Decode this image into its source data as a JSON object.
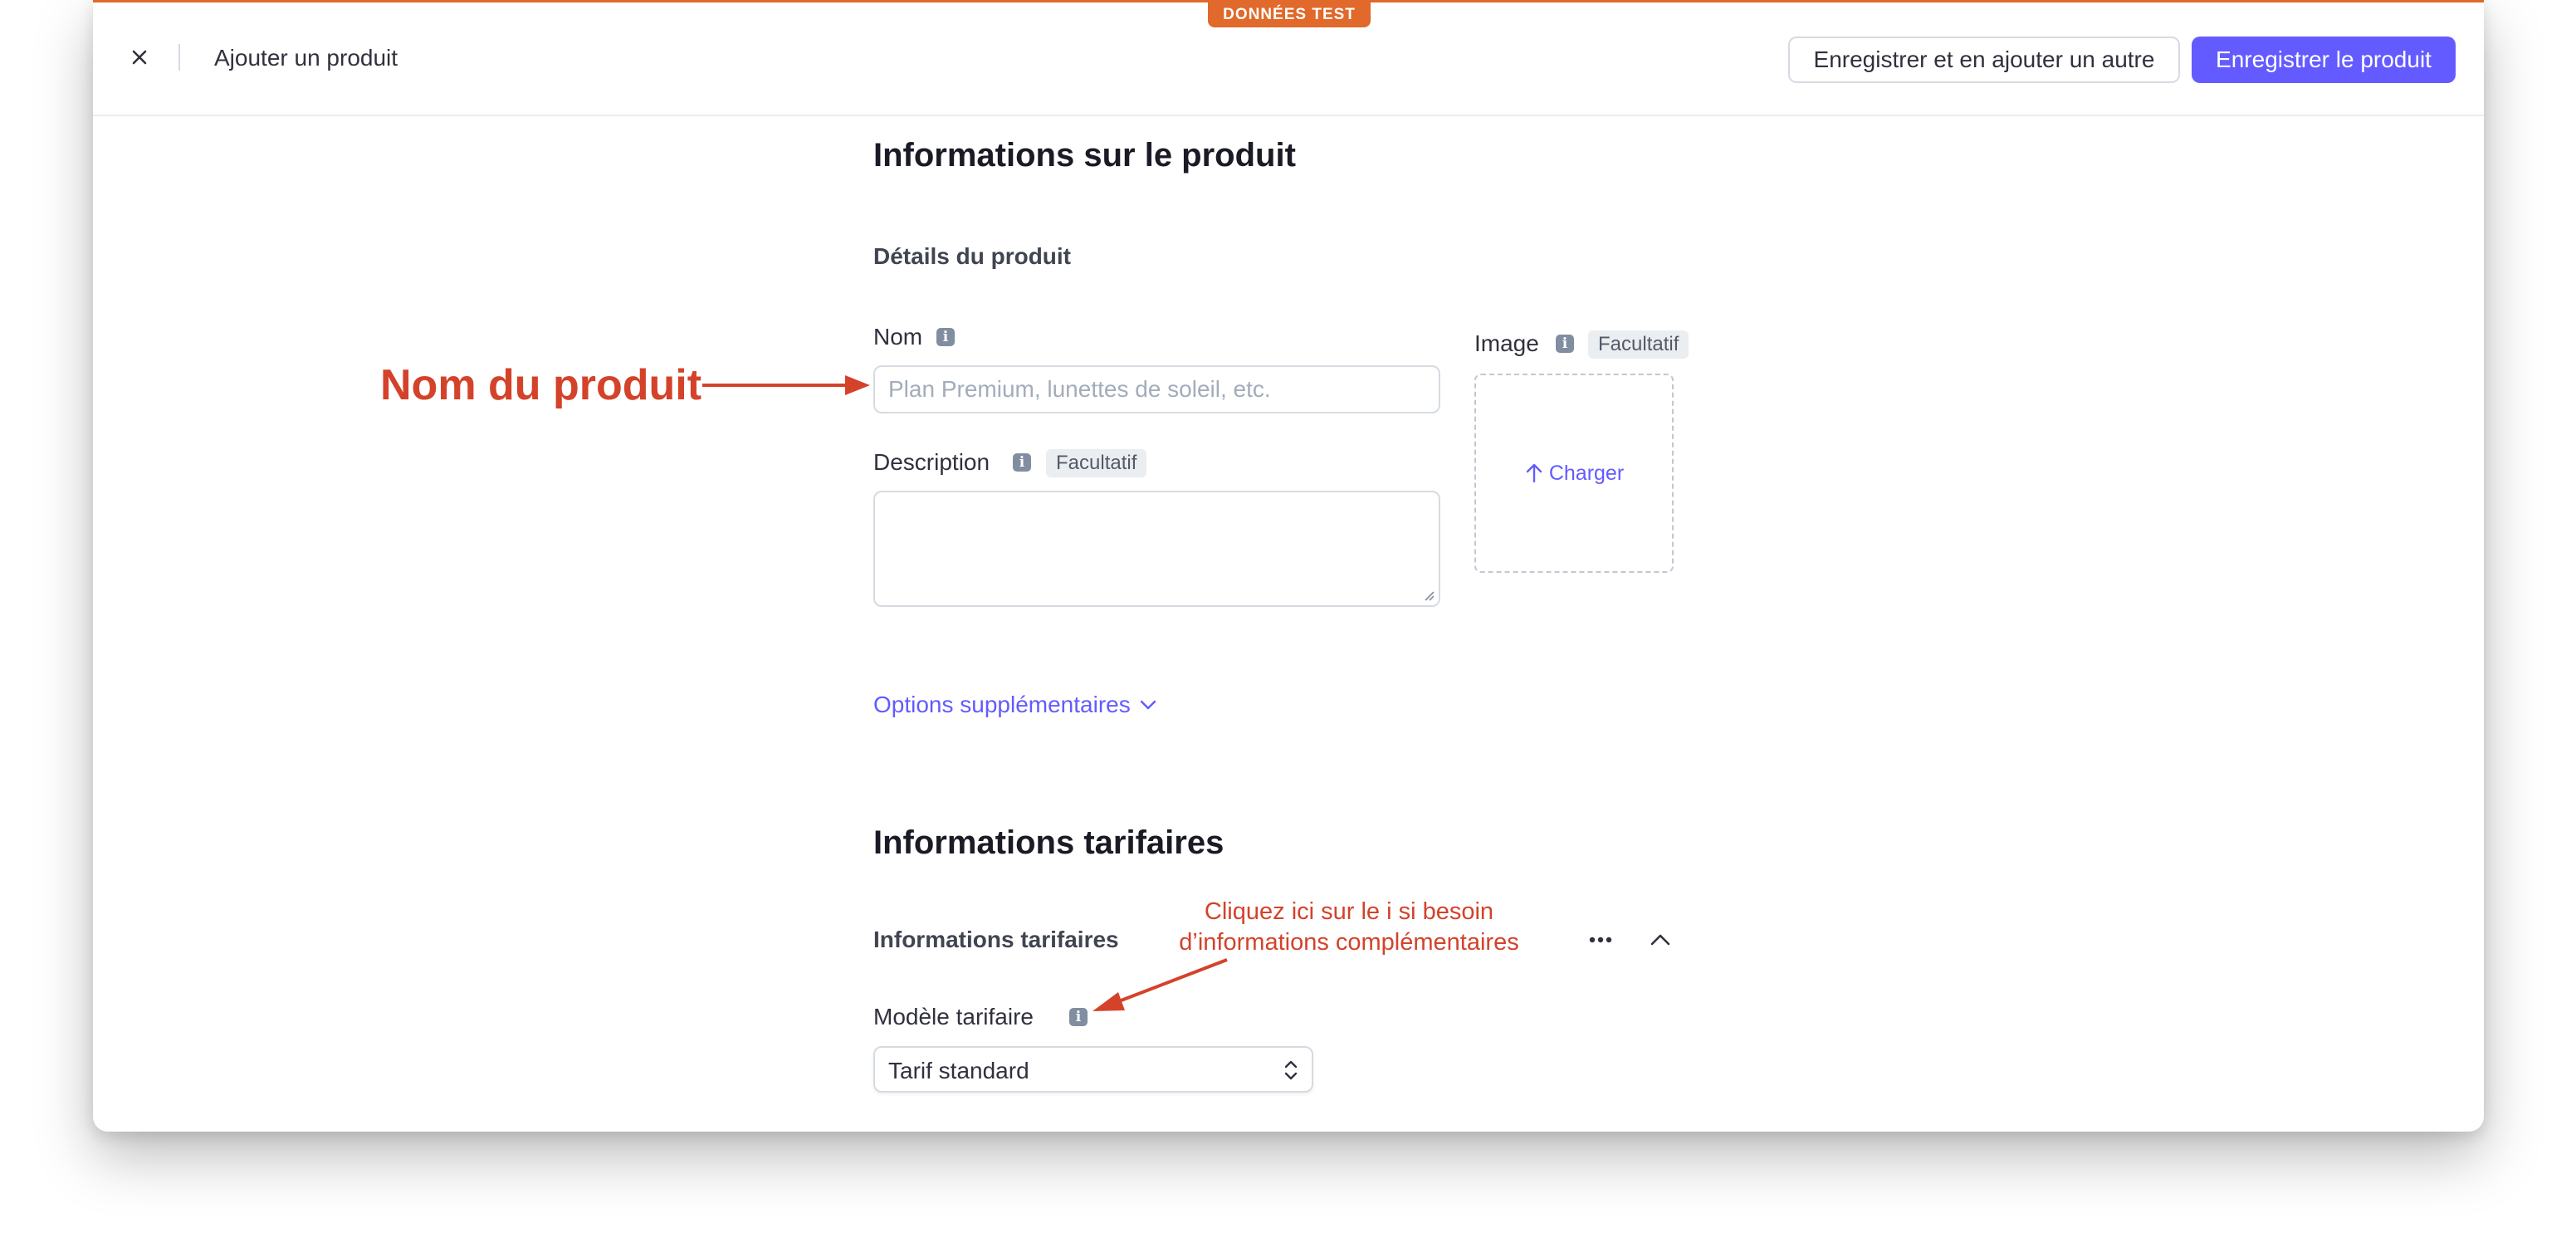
{
  "banner": {
    "test_mode": "DONNÉES TEST"
  },
  "header": {
    "title": "Ajouter un produit",
    "save_add_another": "Enregistrer et en ajouter un autre",
    "save_product": "Enregistrer le produit"
  },
  "product_info": {
    "heading": "Informations sur le produit",
    "details_heading": "Détails du produit",
    "name_label": "Nom",
    "name_placeholder": "Plan Premium, lunettes de soleil, etc.",
    "name_value": "",
    "description_label": "Description",
    "description_value": "",
    "optional": "Facultatif",
    "image_label": "Image",
    "upload_label": "Charger",
    "more_options": "Options supplémentaires"
  },
  "pricing": {
    "heading": "Informations tarifaires",
    "subheading": "Informations tarifaires",
    "model_label": "Modèle tarifaire",
    "model_value": "Tarif standard"
  },
  "annotations": {
    "name_callout": "Nom du produit",
    "info_callout_line1": "Cliquez ici sur le i si besoin",
    "info_callout_line2": "d’informations complémentaires"
  },
  "icons": {
    "info": "i",
    "close": "close-icon",
    "upload": "arrow-up-icon",
    "chevron_down": "chevron-down-icon",
    "more": "ellipsis-icon",
    "collapse": "chevron-up-icon",
    "select": "chevron-updown-icon"
  },
  "colors": {
    "accent": "#635bff",
    "test_mode": "#e0692b",
    "annotation": "#d4422a"
  }
}
